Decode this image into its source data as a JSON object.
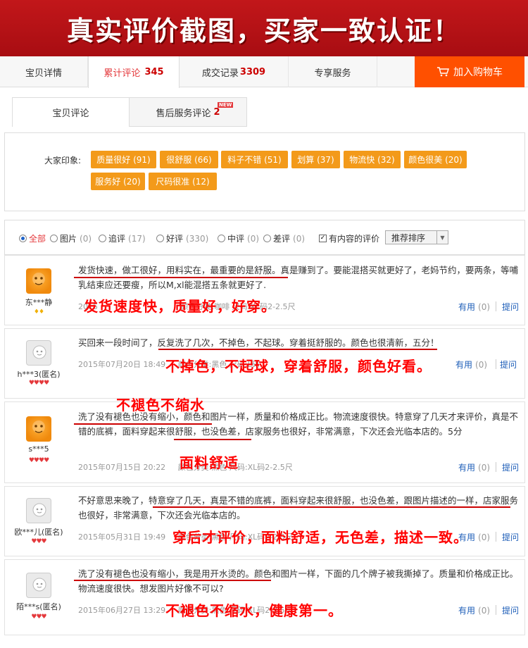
{
  "banner": {
    "title": "真实评价截图，买家一致认证！"
  },
  "tabs": [
    {
      "label": "宝贝详情",
      "count": ""
    },
    {
      "label": "累计评论",
      "count": "345"
    },
    {
      "label": "成交记录",
      "count": "3309"
    },
    {
      "label": "专享服务",
      "count": ""
    }
  ],
  "cart": {
    "label": "加入购物车"
  },
  "subtabs": [
    {
      "label": "宝贝评论",
      "count": ""
    },
    {
      "label": "售后服务评论",
      "count": "2"
    }
  ],
  "new_badge": "NEW",
  "impressions": {
    "label": "大家印象:",
    "tags": [
      "质量很好 (91)",
      "很舒服 (66)",
      "料子不错 (51)",
      "划算 (37)",
      "物流快 (32)",
      "颜色很美 (20)",
      "服务好 (20)",
      "尺码很准 (12)"
    ]
  },
  "filters": [
    {
      "label": "全部",
      "count": ""
    },
    {
      "label": "图片",
      "count": "(0)"
    },
    {
      "label": "追评",
      "count": "(17)"
    },
    {
      "label": "好评",
      "count": "(330)"
    },
    {
      "label": "中评",
      "count": "(0)"
    },
    {
      "label": "差评",
      "count": "(0)"
    }
  ],
  "content_filter": {
    "label": "有内容的评价",
    "check": "✓"
  },
  "sort": {
    "label": "推荐排序",
    "arrow": "▼"
  },
  "review_actions": {
    "useful": "有用",
    "reply": "提问"
  },
  "reviews": [
    {
      "user": "东***静",
      "rank": "♦♦",
      "text": "发货快速，做工很好，用料实在，最重要的是舒服。真是赚到了。要能混搭买就更好了，老妈节约，要两条，等哺乳结束应还要瘦，所以M,xl能混搭五条就更好了.",
      "date": "2015",
      "spec": "颜色分类:咖啡 尺码:XL码2-2.5尺",
      "useful": "(0)",
      "note": "发货速度快，质量好，好穿。"
    },
    {
      "user": "h***3(匿名)",
      "rank": "♥♥♥♥",
      "text": "买回来一段时间了，反复洗了几次，不掉色，不起球。穿着挺舒服的。颜色也很清新，五分！",
      "date": "2015年07月20日 18:49",
      "spec": "颜色分类:黑色 尺码:L码",
      "useful": "(0)",
      "note": "不掉色，不起球，穿着舒服，颜色好看。"
    },
    {
      "user": "s***5",
      "rank": "♥♥♥♥",
      "text": "洗了没有褪色也没有缩小，颜色和图片一样，质量和价格成正比。物流速度很快。特意穿了几天才来评价，真是不错的底裤，面料穿起来很舒服，也没色差，店家服务也很好，非常满意，下次还会光临本店的。5分",
      "date": "2015年07月15日 20:22",
      "spec": "颜色分类:黑色 尺码:XL码2-2.5尺",
      "useful": "(0)",
      "note_top": "不褪色不缩水",
      "note": "面料舒适"
    },
    {
      "user": "欧***儿(匿名)",
      "rank": "♥♥♥",
      "text": "不好意思来晚了，特意穿了几天，真是不错的底裤，面料穿起来很舒服，也没色差，跟图片描述的一样，店家服务也很好，非常满意，下次还会光临本店的。",
      "date": "2015年05月31日 19:49",
      "spec": "颜色分类:黑色 尺码:XL码2-2.5尺",
      "useful": "(0)",
      "note": "穿后才评价，面料舒适，无色差，描述一致。"
    },
    {
      "user": "陌***s(匿名)",
      "rank": "♥♥♥",
      "text": "洗了没有褪色也没有缩小，我是用开水烫的。颜色和图片一样，下面的几个牌子被我撕掉了。质量和价格成正比。物流速度很快。想发图片好像不可以?",
      "date": "2015年06月27日 13:29",
      "spec": "颜色分类:黑色 尺码:XL码2-2.5尺",
      "useful": "(0)",
      "note": "不褪色不缩水，健康第一。"
    }
  ],
  "colors": {
    "banner": "#b01015",
    "cart": "#ff5000",
    "tag": "#f39a1a",
    "annotation": "#ff0000",
    "link": "#1e5eb8"
  }
}
